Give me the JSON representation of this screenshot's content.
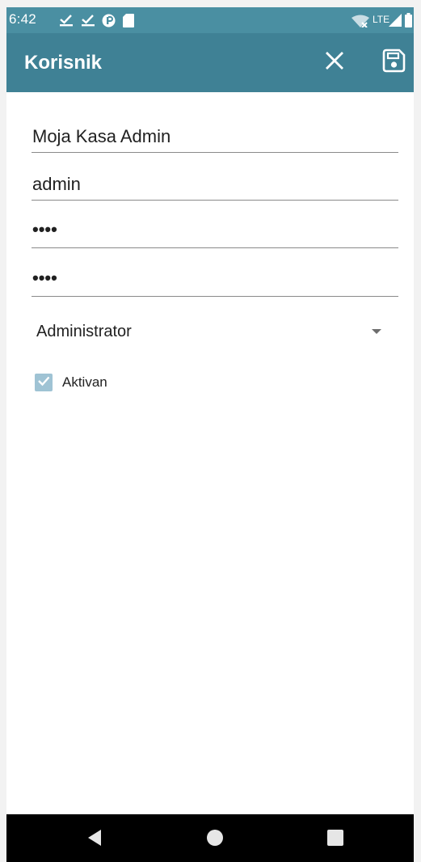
{
  "status_bar": {
    "time": "6:42",
    "network_label": "LTE",
    "icons": [
      "download-done-icon",
      "download-done-icon",
      "p-circle-icon",
      "sd-card-icon",
      "wifi-off-icon",
      "signal-icon",
      "battery-icon"
    ]
  },
  "app_bar": {
    "title": "Korisnik",
    "actions": [
      "close-icon",
      "save-icon"
    ]
  },
  "form": {
    "name_value": "Moja Kasa Admin",
    "username_value": "admin",
    "password_value": "••••",
    "password_confirm_value": "••••",
    "role_selected": "Administrator",
    "active_checked": true,
    "active_label": "Aktivan"
  },
  "colors": {
    "status_bar": "#4a8fa2",
    "app_bar": "#3f8195",
    "checkbox": "#9fc3d4",
    "nav_bar": "#000000"
  }
}
